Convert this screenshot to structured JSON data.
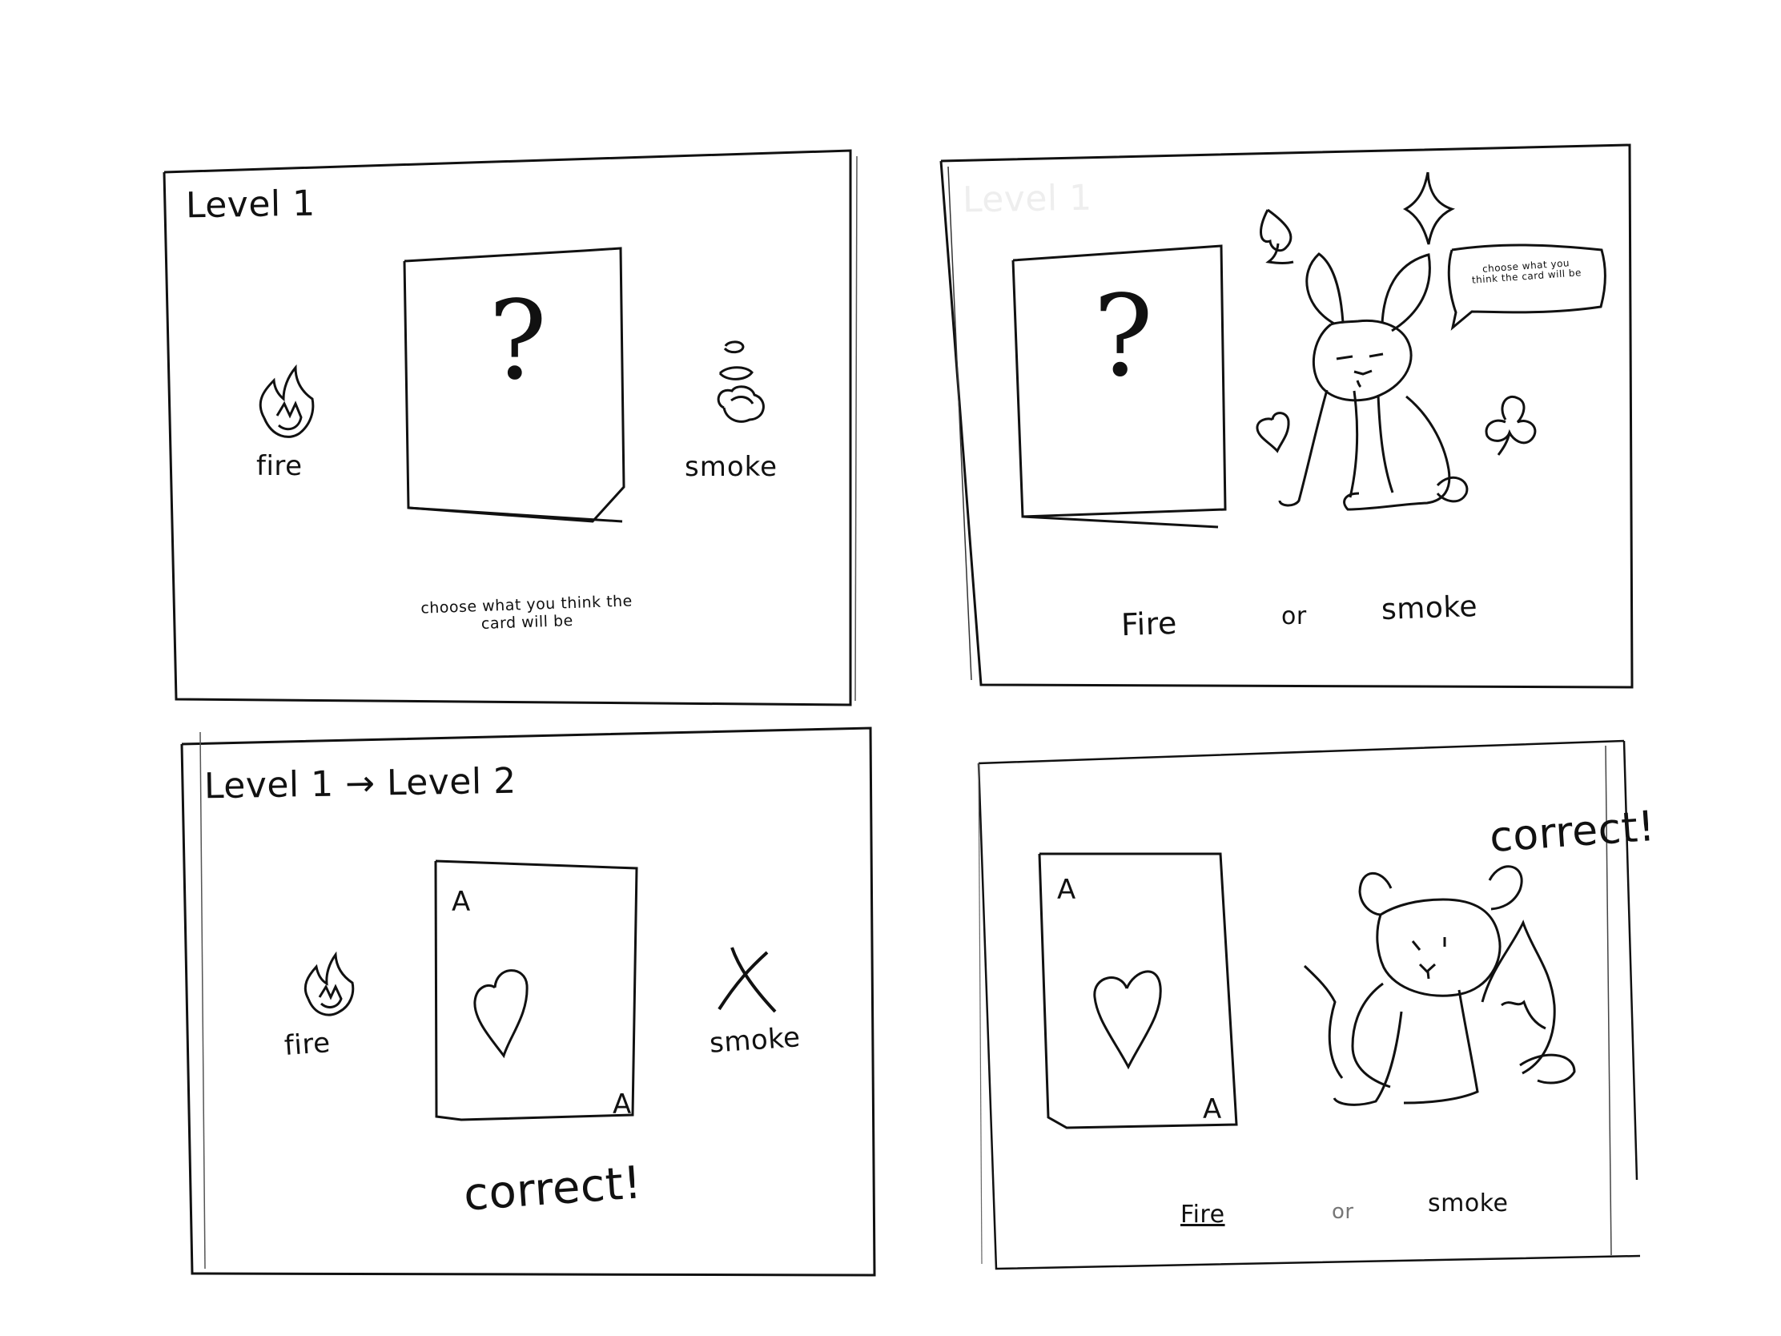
{
  "storyboard": {
    "panels": [
      {
        "level_label": "Level 1",
        "card_symbol": "?",
        "option_left": "fire",
        "option_right": "smoke",
        "instruction": "choose what you think the card will be"
      },
      {
        "faint_label": "Level 1",
        "card_symbol": "?",
        "speech_text": "choose what you think the card will be",
        "option_left": "Fire",
        "or_text": "or",
        "option_right": "smoke"
      },
      {
        "level_label": "Level 1 → Level 2",
        "card_corner_top": "A",
        "card_corner_bottom": "A",
        "option_left": "fire",
        "option_right": "smoke",
        "result": "correct!"
      },
      {
        "card_corner_top": "A",
        "card_corner_bottom": "A",
        "result": "correct!",
        "option_left": "Fire",
        "or_text": "or",
        "option_right": "smoke"
      }
    ]
  }
}
